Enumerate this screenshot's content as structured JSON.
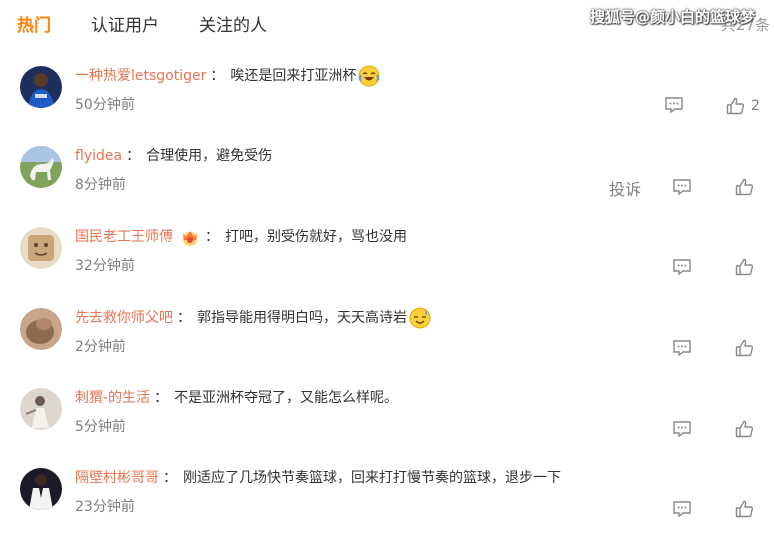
{
  "tabs": [
    {
      "label": "热门",
      "active": true
    },
    {
      "label": "认证用户",
      "active": false
    },
    {
      "label": "关注的人",
      "active": false
    }
  ],
  "total_count": "共27条",
  "watermark": "搜狐号@颜小白的篮球梦",
  "colors": {
    "accent": "#ff8200",
    "username": "#eb7350",
    "meta": "#808080"
  },
  "comments": [
    {
      "username": "一种热爱letsgotiger",
      "colon": "：",
      "text": "唉还是回来打亚洲杯",
      "emoji": "laugh-cry",
      "time": "50分钟前",
      "like_count": "2",
      "avatar": "player-blue-jersey"
    },
    {
      "username": "flyidea",
      "colon": "：",
      "text": "合理使用，避免受伤",
      "time": "8分钟前",
      "report": "投诉",
      "like_count": "",
      "avatar": "white-horse"
    },
    {
      "username": "国民老工王师傅",
      "colon": "：",
      "text": "打吧，别受伤就好，骂也没用",
      "badge": "crown-badge",
      "time": "32分钟前",
      "like_count": "",
      "avatar": "beige-cartoon"
    },
    {
      "username": "先去救你师父吧",
      "colon": "：",
      "text": "郭指导能用得明白吗，天天高诗岩",
      "emoji": "sweat-smile",
      "time": "2分钟前",
      "like_count": "",
      "avatar": "brown-animal"
    },
    {
      "username": "刺猬-的生活",
      "colon": "：",
      "text": "不是亚洲杯夺冠了，又能怎么样呢。",
      "time": "5分钟前",
      "like_count": "",
      "avatar": "pale-figure"
    },
    {
      "username": "隔壁村彬哥哥",
      "colon": "：",
      "text": "刚适应了几场快节奏篮球，回来打打慢节奏的篮球，退步一下",
      "time": "23分钟前",
      "like_count": "",
      "avatar": "man-white-suit"
    }
  ]
}
